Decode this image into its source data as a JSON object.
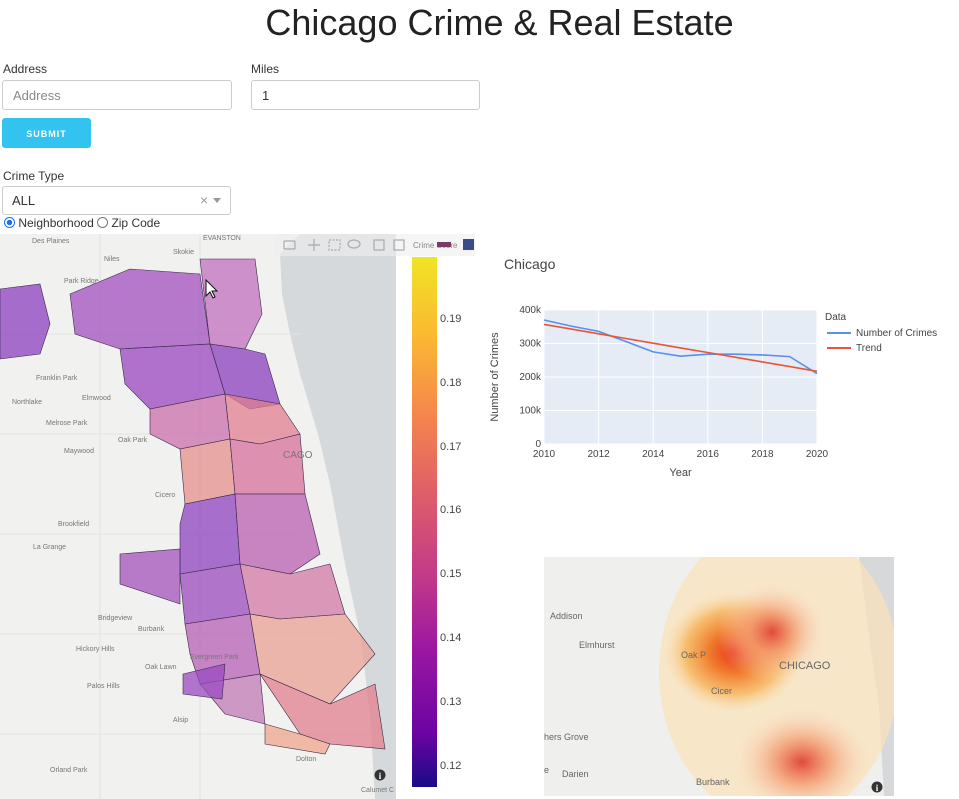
{
  "page": {
    "title": "Chicago Crime & Real Estate"
  },
  "form": {
    "address_label": "Address",
    "address_placeholder": "Address",
    "miles_label": "Miles",
    "miles_value": "1",
    "submit_label": "SUBMIT",
    "crime_type_label": "Crime Type",
    "crime_type_value": "ALL",
    "clear_glyph": "×",
    "radio_neighborhood": "Neighborhood",
    "radio_zip": "Zip Code"
  },
  "choropleth": {
    "colorbar_title": "Crime Score",
    "colorbar_ticks": [
      "0.19",
      "0.18",
      "0.17",
      "0.16",
      "0.15",
      "0.14",
      "0.13",
      "0.12"
    ],
    "map_labels": [
      "EVANSTON",
      "Des Plaines",
      "Skokie",
      "Niles",
      "Park Ridge",
      "Franklin Park",
      "Northlake",
      "Elmwood",
      "Melrose Park",
      "Oak Park",
      "Maywood",
      "Cicero",
      "Brookfield",
      "La Grange",
      "Bridgeview",
      "Burbank",
      "Hickory Hills",
      "Oak Lawn",
      "Evergreen Park",
      "Palos Hills",
      "Alsip",
      "Orland Park",
      "Dolton",
      "Calumet C",
      "CAGO"
    ],
    "icons": [
      "camera-icon",
      "pan-icon",
      "box-select-icon",
      "lasso-icon",
      "zoom-in-icon",
      "zoom-out-icon",
      "plotly-logo-icon"
    ]
  },
  "chart_data": {
    "type": "line",
    "title": "Chicago",
    "xlabel": "Year",
    "ylabel": "Number of Crimes",
    "legend_title": "Data",
    "legend_position": "right",
    "xlim": [
      2010,
      2020
    ],
    "ylim": [
      0,
      400000
    ],
    "x_ticks": [
      "2010",
      "2012",
      "2014",
      "2016",
      "2018",
      "2020"
    ],
    "y_ticks": [
      "0",
      "100k",
      "200k",
      "300k",
      "400k"
    ],
    "grid": true,
    "x": [
      2010,
      2011,
      2012,
      2013,
      2014,
      2015,
      2016,
      2017,
      2018,
      2019,
      2020
    ],
    "series": [
      {
        "name": "Number of Crimes",
        "color": "#5b8fe8",
        "values": [
          370000,
          352000,
          336000,
          306000,
          275000,
          262000,
          268000,
          268000,
          266000,
          261000,
          210000
        ]
      },
      {
        "name": "Trend",
        "color": "#e8553a",
        "values": [
          357000,
          343000,
          329000,
          315000,
          301000,
          287000,
          273000,
          259000,
          245000,
          231000,
          217000
        ]
      }
    ]
  },
  "heatmap": {
    "labels": [
      "Addison",
      "Elmhurst",
      "Oak P",
      "CHICAGO",
      "Cicer",
      "hers Grove",
      "e",
      "Darien",
      "Burbank"
    ]
  }
}
